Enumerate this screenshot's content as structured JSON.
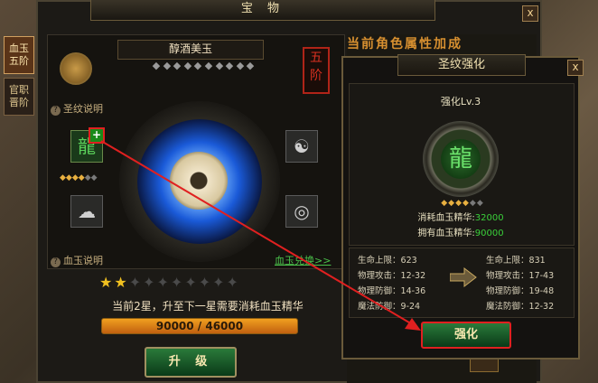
{
  "main": {
    "title": "宝 物",
    "close": "x",
    "tabs": [
      {
        "label_line1": "血玉",
        "label_line2": "五阶",
        "active": true
      },
      {
        "label_line1": "官职",
        "label_line2": "晋阶",
        "active": false
      }
    ],
    "jade_name": "醇酒美玉",
    "rank_seal": [
      "五",
      "阶"
    ],
    "rune_help": "圣纹说明",
    "blood_help": "血玉说明",
    "blood_link": "血玉兑换>>",
    "stars_filled": 2,
    "stars_total": 10,
    "cost_text": "当前2星，升至下一星需要消耗血玉精华",
    "progress_label": "90000 / 46000",
    "upgrade_label": "升 级"
  },
  "banner_text": "当前角色属性加成",
  "popup": {
    "title": "圣纹强化",
    "close": "x",
    "level_label": "强化Lv.3",
    "consume_label": "消耗血玉精华:",
    "consume_value": "32000",
    "own_label": "拥有血玉精华:",
    "own_value": "90000",
    "current_stats": [
      {
        "label": "生命上限",
        "value": "623"
      },
      {
        "label": "物理攻击",
        "value": "12-32"
      },
      {
        "label": "物理防御",
        "value": "14-36"
      },
      {
        "label": "魔法防御",
        "value": "9-24"
      }
    ],
    "next_stats": [
      {
        "label": "生命上限",
        "value": "831"
      },
      {
        "label": "物理攻击",
        "value": "17-43"
      },
      {
        "label": "物理防御",
        "value": "19-48"
      },
      {
        "label": "魔法防御",
        "value": "12-32"
      }
    ],
    "enhance_label": "强化"
  },
  "colors": {
    "accent_green": "#3ad03a",
    "annotation_red": "#e02020",
    "seal_red": "#d83020",
    "progress_orange": "#f0a020"
  }
}
